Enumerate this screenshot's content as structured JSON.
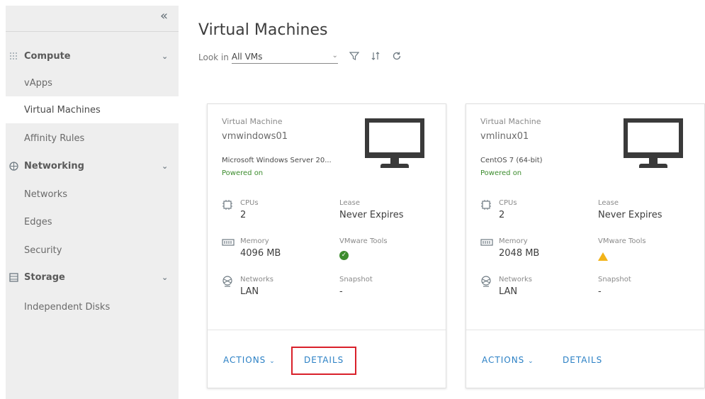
{
  "sidebar": {
    "collapse_icon": "double-chevron-left-icon",
    "groups": [
      {
        "label": "Compute",
        "icon": "compute-grid-icon",
        "items": [
          "vApps",
          "Virtual Machines",
          "Affinity Rules"
        ]
      },
      {
        "label": "Networking",
        "icon": "network-icon",
        "items": [
          "Networks",
          "Edges",
          "Security"
        ]
      },
      {
        "label": "Storage",
        "icon": "storage-icon",
        "items": [
          "Independent Disks"
        ]
      }
    ],
    "active_item": "Virtual Machines"
  },
  "main": {
    "title": "Virtual Machines",
    "look_in_label": "Look in",
    "look_in_value": "All VMs",
    "toolbar_icons": [
      "filter-icon",
      "sort-icon",
      "refresh-icon"
    ]
  },
  "cards": [
    {
      "type_label": "Virtual Machine",
      "name": "vmwindows01",
      "os": "Microsoft Windows Server 20...",
      "power": "Powered on",
      "cpus_label": "CPUs",
      "cpus": "2",
      "lease_label": "Lease",
      "lease": "Never Expires",
      "memory_label": "Memory",
      "memory": "4096 MB",
      "tools_label": "VMware Tools",
      "tools_status": "ok",
      "networks_label": "Networks",
      "networks": "LAN",
      "snapshot_label": "Snapshot",
      "snapshot": "-",
      "actions_label": "ACTIONS",
      "details_label": "DETAILS"
    },
    {
      "type_label": "Virtual Machine",
      "name": "vmlinux01",
      "os": "CentOS 7 (64-bit)",
      "power": "Powered on",
      "cpus_label": "CPUs",
      "cpus": "2",
      "lease_label": "Lease",
      "lease": "Never Expires",
      "memory_label": "Memory",
      "memory": "2048 MB",
      "tools_label": "VMware Tools",
      "tools_status": "warning",
      "networks_label": "Networks",
      "networks": "LAN",
      "snapshot_label": "Snapshot",
      "snapshot": "-",
      "actions_label": "ACTIONS",
      "details_label": "DETAILS"
    }
  ],
  "colors": {
    "accent": "#2b80c5",
    "powered_on": "#3c8c2d",
    "highlight": "#d9202a",
    "warning": "#f2b318"
  }
}
